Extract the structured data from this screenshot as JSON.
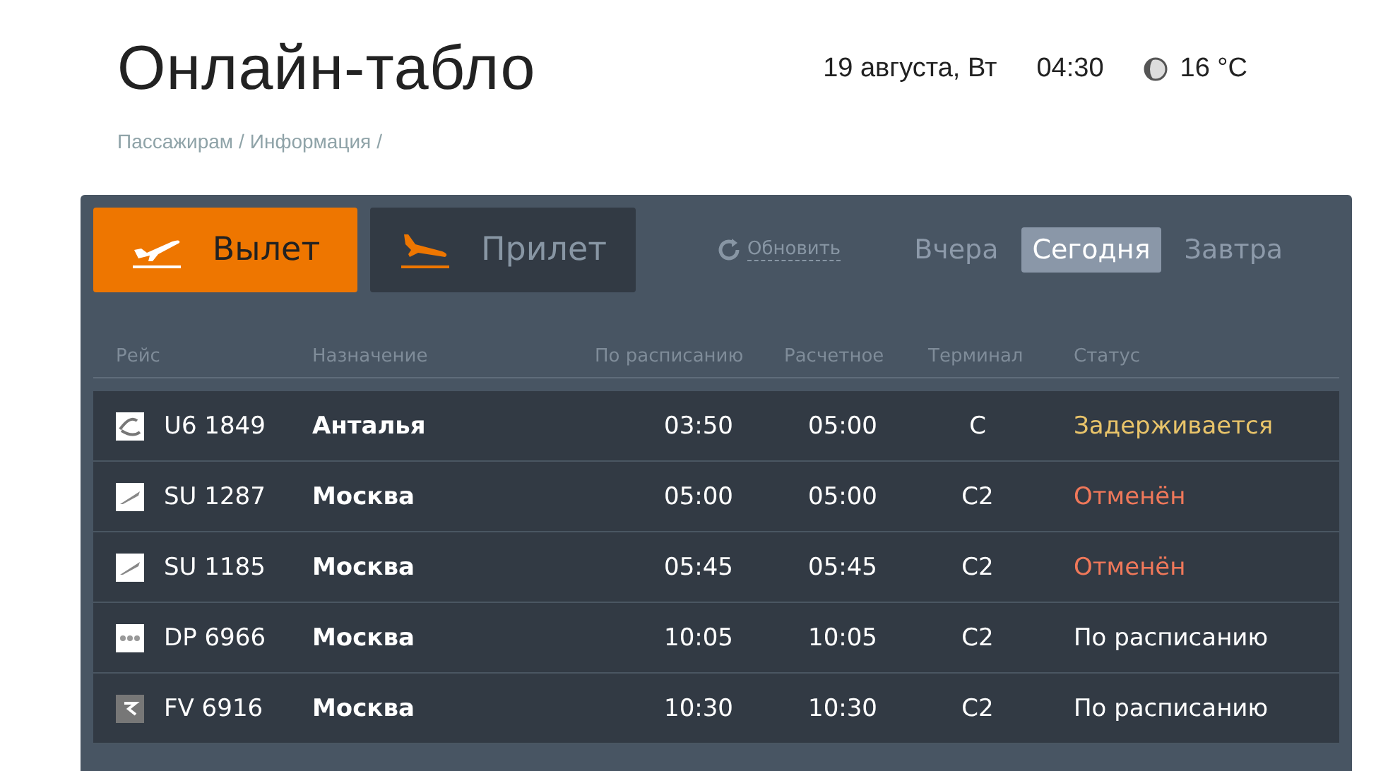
{
  "header": {
    "title": "Онлайн-табло",
    "date": "19 августа, Вт",
    "time": "04:30",
    "temperature": "16 °C"
  },
  "breadcrumbs": [
    {
      "label": "Пассажирам",
      "separator": "/"
    },
    {
      "label": "Информация",
      "separator": "/"
    }
  ],
  "direction_tabs": [
    {
      "label": "Вылет",
      "kind": "departure",
      "selected": true
    },
    {
      "label": "Прилет",
      "kind": "arrival",
      "selected": false
    }
  ],
  "refresh": "Обновить",
  "day_tabs": [
    {
      "label": "Вчера",
      "selected": false
    },
    {
      "label": "Сегодня",
      "selected": true
    },
    {
      "label": "Завтра",
      "selected": false
    }
  ],
  "table": {
    "columns": [
      "Рейс",
      "Назначение",
      "По расписанию",
      "Расчетное",
      "Терминал",
      "Статус"
    ],
    "rows": [
      {
        "kind": "swirl",
        "flight": "U6 1849",
        "destination": "Анталья",
        "scheduled": "03:50",
        "estimated": "05:00",
        "terminal": "C",
        "status": "Задерживается",
        "color": "#e9c46a"
      },
      {
        "kind": "plane",
        "flight": "SU 1287",
        "destination": "Москва",
        "scheduled": "05:00",
        "estimated": "05:00",
        "terminal": "C2",
        "status": "Отменён",
        "color": "#f0785a"
      },
      {
        "kind": "plane",
        "flight": "SU 1185",
        "destination": "Москва",
        "scheduled": "05:45",
        "estimated": "05:45",
        "terminal": "C2",
        "status": "Отменён",
        "color": "#f0785a"
      },
      {
        "kind": "dots",
        "flight": "DP 6966",
        "destination": "Москва",
        "scheduled": "10:05",
        "estimated": "10:05",
        "terminal": "C2",
        "status": "По расписанию",
        "color": "#ffffff"
      },
      {
        "kind": "mark",
        "flight": "FV 6916",
        "destination": "Москва",
        "scheduled": "10:30",
        "estimated": "10:30",
        "terminal": "C2",
        "status": "По расписанию",
        "color": "#ffffff"
      }
    ]
  }
}
